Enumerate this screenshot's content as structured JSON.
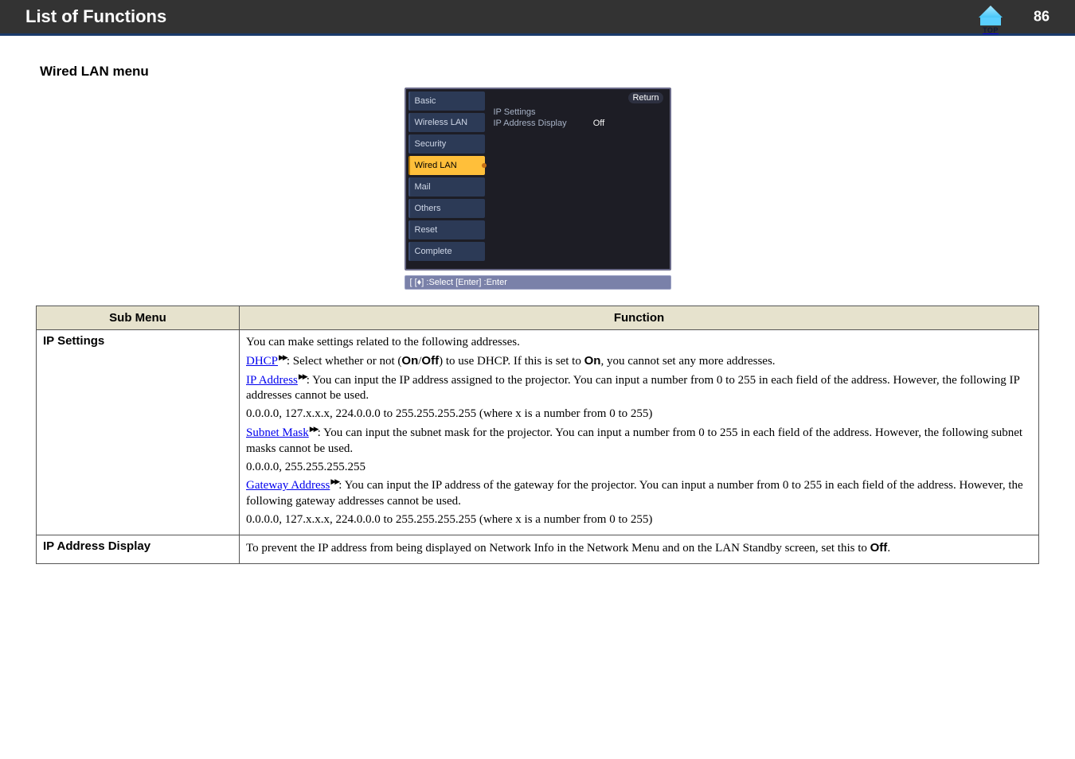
{
  "page": {
    "header_title": "List of Functions",
    "number": "86",
    "top_label": "TOP"
  },
  "section": {
    "title": "Wired LAN menu"
  },
  "osd": {
    "tabs": {
      "basic": "Basic",
      "wireless": "Wireless LAN",
      "security": "Security",
      "wired": "Wired LAN",
      "mail": "Mail",
      "others": "Others",
      "reset": "Reset",
      "complete": "Complete"
    },
    "right": {
      "return": "Return",
      "ip_settings": "IP Settings",
      "ip_display_label": "IP Address Display",
      "ip_display_value": "Off"
    },
    "hint": "[ [♦] :Select  [Enter] :Enter"
  },
  "table": {
    "headers": {
      "submenu": "Sub Menu",
      "function": "Function"
    },
    "rows": {
      "ip_settings": {
        "name": "IP Settings",
        "intro": "You can make settings related to the following addresses.",
        "dhcp_term": "DHCP",
        "dhcp_rest": ": Select whether or not (",
        "dhcp_on": "On",
        "dhcp_slash": "/",
        "dhcp_off": "Off",
        "dhcp_after": ") to use DHCP. If this is set to ",
        "dhcp_on2": "On",
        "dhcp_tail": ", you cannot set any more addresses.",
        "ip_term": "IP Address",
        "ip_rest": ": You can input the IP address assigned to the projector. You can input a number from 0 to 255 in each field of the address. However, the following IP addresses cannot be used.",
        "ip_range": "0.0.0.0, 127.x.x.x, 224.0.0.0 to 255.255.255.255 (where x is a number from 0 to 255)",
        "subnet_term": "Subnet Mask",
        "subnet_rest": ": You can input the subnet mask for the projector. You can input a number from 0 to 255 in each field of the address. However, the following subnet masks cannot be used.",
        "subnet_range": "0.0.0.0, 255.255.255.255",
        "gateway_term": "Gateway Address",
        "gateway_rest": ": You can input the IP address of the gateway for the projector. You can input a number from 0 to 255 in each field of the address. However, the following gateway addresses cannot be used.",
        "gateway_range": "0.0.0.0, 127.x.x.x, 224.0.0.0 to 255.255.255.255 (where x is a number from 0 to 255)"
      },
      "ip_display": {
        "name": "IP Address Display",
        "pre": "To prevent the IP address from being displayed on Network Info in the Network Menu and on the LAN Standby screen, set this to ",
        "bold": "Off",
        "post": "."
      }
    }
  }
}
